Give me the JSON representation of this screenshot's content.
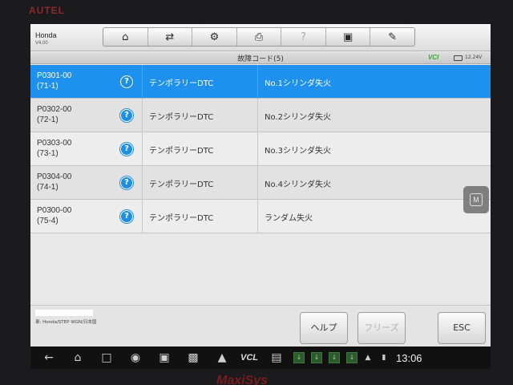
{
  "device": {
    "brand": "AUTEL",
    "model": "MaxiSys"
  },
  "header": {
    "app_name": "Honda",
    "app_version": "V4.00",
    "toolbar": [
      {
        "name": "home-icon",
        "glyph": "⌂",
        "disabled": false
      },
      {
        "name": "vehicle-swap-icon",
        "glyph": "⇄",
        "disabled": false
      },
      {
        "name": "gear-icon",
        "glyph": "⚙",
        "disabled": false
      },
      {
        "name": "printer-icon",
        "glyph": "⎙",
        "disabled": false
      },
      {
        "name": "help-icon",
        "glyph": "?",
        "disabled": true
      },
      {
        "name": "save-icon",
        "glyph": "▣",
        "disabled": false
      },
      {
        "name": "pen-icon",
        "glyph": "✎",
        "disabled": false
      }
    ]
  },
  "subheader": {
    "title": "故障コード(5)",
    "vci_label": "VCI",
    "voltage": "12.24V"
  },
  "dtc_list": [
    {
      "code": "P0301-00",
      "sub": "(71-1)",
      "status": "テンポラリーDTC",
      "description": "No.1シリンダ失火",
      "selected": true
    },
    {
      "code": "P0302-00",
      "sub": "(72-1)",
      "status": "テンポラリーDTC",
      "description": "No.2シリンダ失火",
      "selected": false
    },
    {
      "code": "P0303-00",
      "sub": "(73-1)",
      "status": "テンポラリーDTC",
      "description": "No.3シリンダ失火",
      "selected": false
    },
    {
      "code": "P0304-00",
      "sub": "(74-1)",
      "status": "テンポラリーDTC",
      "description": "No.4シリンダ失火",
      "selected": false
    },
    {
      "code": "P0300-00",
      "sub": "(75-4)",
      "status": "テンポラリーDTC",
      "description": "ランダム失火",
      "selected": false
    }
  ],
  "footer": {
    "vehicle_info": "車: Honda/STEP WGN/日本国",
    "help_label": "ヘルプ",
    "freeze_label": "フリーズ",
    "esc_label": "ESC"
  },
  "side_button": {
    "label": "M"
  },
  "navbar": {
    "vcl_label": "VCL",
    "time": "13:06"
  },
  "colors": {
    "selected_row": "#1e90ee",
    "help_icon": "#1f8ee0"
  }
}
